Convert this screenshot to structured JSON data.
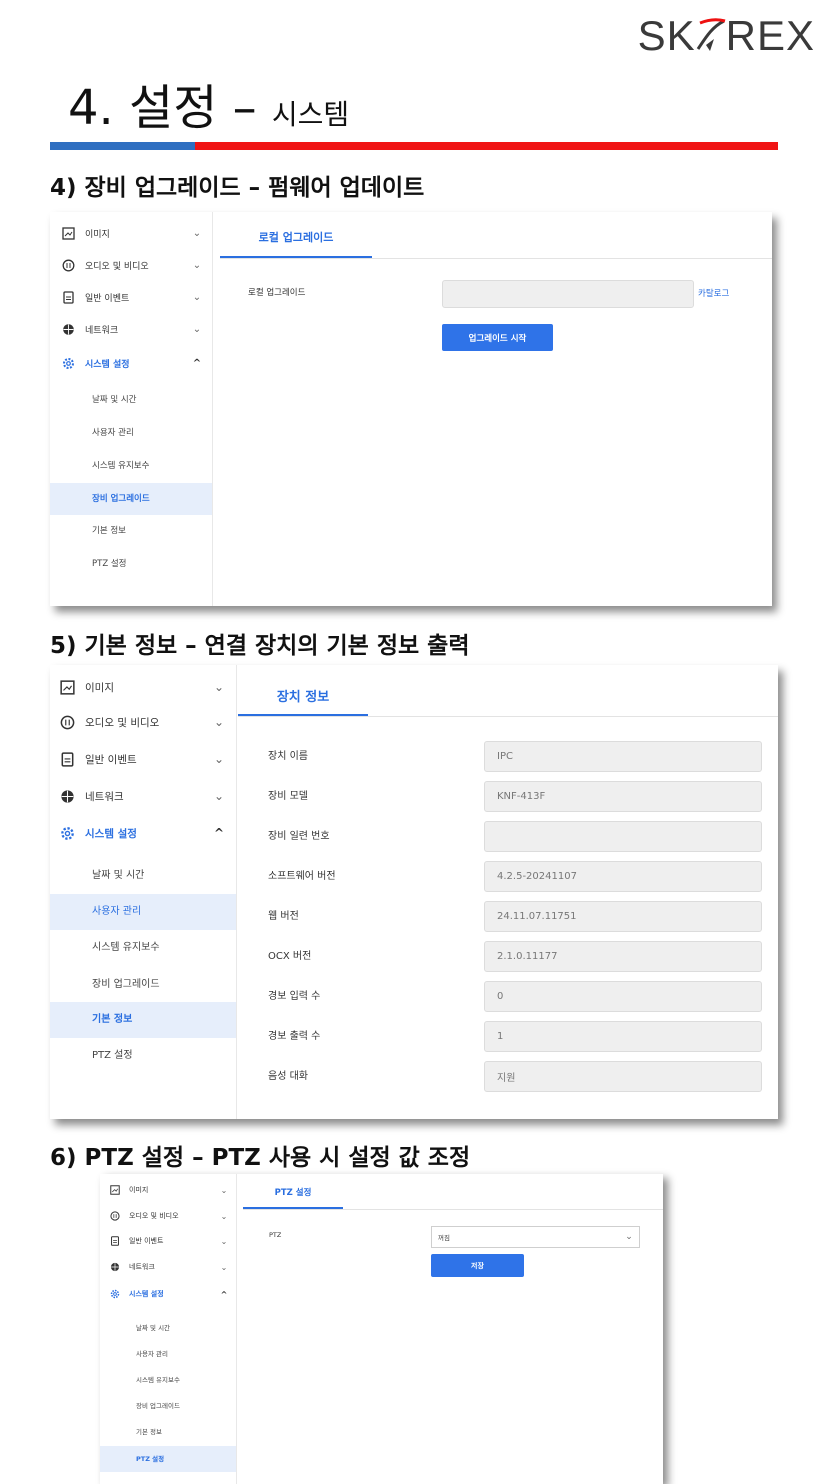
{
  "brand": {
    "logo_text_pre": "SK",
    "logo_text_post": "REX"
  },
  "page": {
    "title_main": "4. 설정",
    "title_dash": " – ",
    "title_sub": "시스템"
  },
  "colors": {
    "accent_blue": "#2f6fc1",
    "accent_red": "#f01414",
    "ui_blue": "#2b6fe0"
  },
  "sections": [
    {
      "heading": "4) 장비 업그레이드 – 펌웨어 업데이트",
      "sidebar": {
        "items": [
          {
            "label": "이미지",
            "icon": "image-icon"
          },
          {
            "label": "오디오 및 비디오",
            "icon": "audio-video-icon"
          },
          {
            "label": "일반 이벤트",
            "icon": "event-icon"
          },
          {
            "label": "네트워크",
            "icon": "globe-icon"
          },
          {
            "label": "시스템 설정",
            "icon": "gear-icon"
          }
        ],
        "subitems": [
          "날짜 및 시간",
          "사용자 관리",
          "시스템 유지보수",
          "장비 업그레이드",
          "기본 정보",
          "PTZ 설정"
        ]
      },
      "tab": "로컬 업그레이드",
      "field_label": "로컬 업그레이드",
      "browse_link": "카탈로그",
      "button": "업그레이드 시작"
    },
    {
      "heading": "5) 기본 정보 – 연결 장치의 기본 정보 출력",
      "sidebar": {
        "items": [
          {
            "label": "이미지",
            "icon": "image-icon"
          },
          {
            "label": "오디오 및 비디오",
            "icon": "audio-video-icon"
          },
          {
            "label": "일반 이벤트",
            "icon": "event-icon"
          },
          {
            "label": "네트워크",
            "icon": "globe-icon"
          },
          {
            "label": "시스템 설정",
            "icon": "gear-icon"
          }
        ],
        "subitems": [
          "날짜 및 시간",
          "사용자 관리",
          "시스템 유지보수",
          "장비 업그레이드",
          "기본 정보",
          "PTZ 설정"
        ]
      },
      "tab": "장치 정보",
      "fields": [
        {
          "label": "장치 이름",
          "value": "IPC"
        },
        {
          "label": "장비 모델",
          "value": "KNF-413F"
        },
        {
          "label": "장비 일련 번호",
          "value": ""
        },
        {
          "label": "소프트웨어 버전",
          "value": "4.2.5-20241107"
        },
        {
          "label": "웹 버전",
          "value": "24.11.07.11751"
        },
        {
          "label": "OCX 버전",
          "value": "2.1.0.11177"
        },
        {
          "label": "경보 입력 수",
          "value": "0"
        },
        {
          "label": "경보 출력 수",
          "value": "1"
        },
        {
          "label": "음성 대화",
          "value": "지원"
        }
      ]
    },
    {
      "heading": "6) PTZ 설정 – PTZ 사용 시 설정 값 조정",
      "sidebar": {
        "items": [
          {
            "label": "이미지",
            "icon": "image-icon"
          },
          {
            "label": "오디오 및 비디오",
            "icon": "audio-video-icon"
          },
          {
            "label": "일반 이벤트",
            "icon": "event-icon"
          },
          {
            "label": "네트워크",
            "icon": "globe-icon"
          },
          {
            "label": "시스템 설정",
            "icon": "gear-icon"
          }
        ],
        "subitems": [
          "날짜 및 시간",
          "사용자 관리",
          "시스템 유지보수",
          "장비 업그레이드",
          "기본 정보",
          "PTZ 설정"
        ]
      },
      "tab": "PTZ 설정",
      "field_label": "PTZ",
      "select_value": "꺼짐",
      "button": "저장"
    }
  ]
}
